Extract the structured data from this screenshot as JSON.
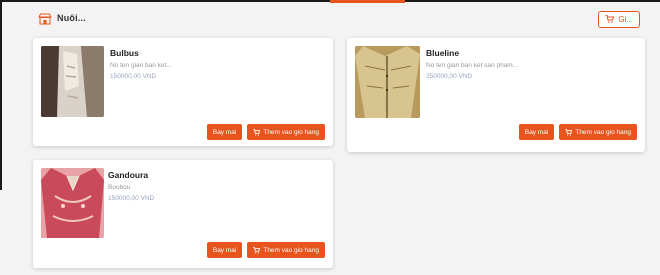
{
  "header": {
    "title": "Nuôi..."
  },
  "toolbar": {
    "top_button_label": "Gi..."
  },
  "colors": {
    "accent": "#e8541e",
    "background": "#f3f3f3",
    "card": "#ffffff"
  },
  "cards": [
    {
      "name": "Bulbus",
      "subtitle": "No ten gian ban ket...",
      "price": "150000,00 VND",
      "button1": "Bay mai",
      "button2": "Them vao gio hang"
    },
    {
      "name": "Blueline",
      "subtitle": "No ten gian ban ket san pham...",
      "price": "250000,00 VND",
      "button1": "Bay mai",
      "button2": "Them vao gio hang"
    },
    {
      "name": "Gandoura",
      "subtitle": "Boubou",
      "price": "150000,00 VND",
      "button1": "Bay mai",
      "button2": "Them vao gio hang"
    }
  ]
}
